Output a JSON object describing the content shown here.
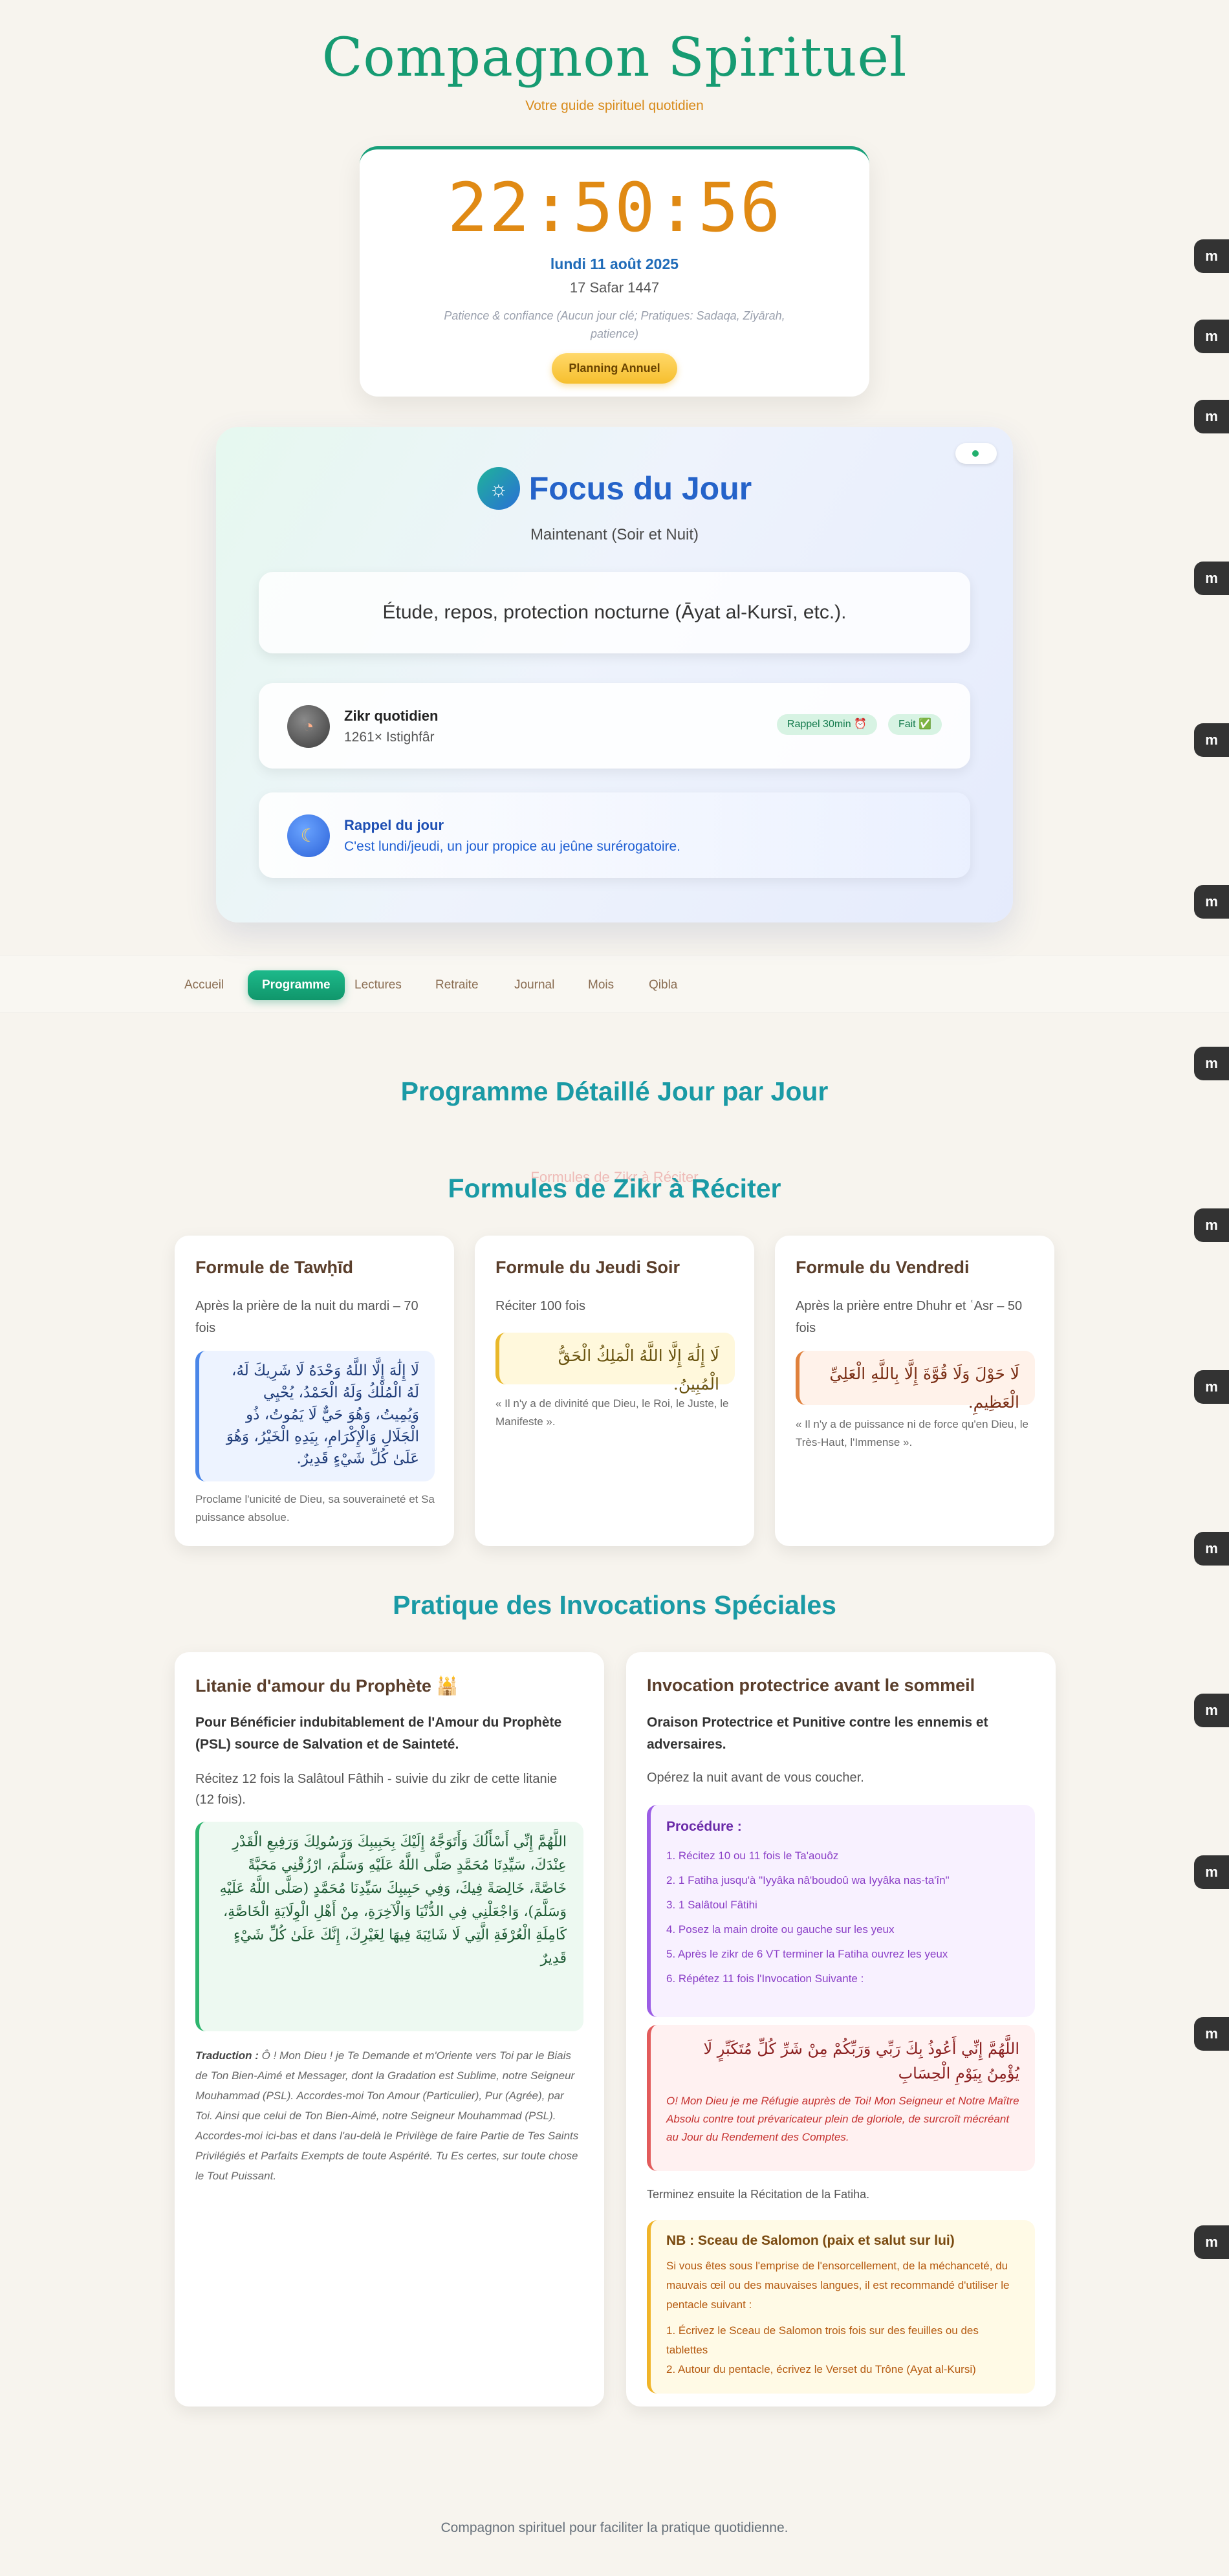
{
  "header": {
    "title": "Compagnon Spirituel",
    "subtitle": "Votre guide spirituel quotidien"
  },
  "clock": {
    "time": "22:50:56",
    "date": "lundi 11 août 2025",
    "hijri": "17 Safar 1447",
    "note": "Patience & confiance (Aucun jour clé; Pratiques: Sadaqa, Ziyārah, patience)",
    "planning_button": "Planning Annuel"
  },
  "focus": {
    "title": "Focus du Jour",
    "subtitle": "Maintenant (Soir et Nuit)",
    "main": "Étude, repos, protection nocturne (Āyat al-Kursī, etc.).",
    "zikr": {
      "title": "Zikr quotidien",
      "text": "1261× Istighfâr",
      "chip_rappel": "Rappel 30min ⏰",
      "chip_fait": "Fait ✅"
    },
    "rappel": {
      "title": "Rappel du jour",
      "text": "C'est lundi/jeudi, un jour propice au jeûne surérogatoire."
    }
  },
  "nav": {
    "items": [
      {
        "label": "Accueil"
      },
      {
        "label": "Programme"
      },
      {
        "label": "Lectures"
      },
      {
        "label": "Retraite"
      },
      {
        "label": "Journal"
      },
      {
        "label": "Mois"
      },
      {
        "label": "Qibla"
      }
    ],
    "active": "Programme"
  },
  "program": {
    "title": "Programme Détaillé Jour par Jour",
    "ghost": "Formules de Zikr à Réciter"
  },
  "formulas": {
    "title": "Formules de Zikr à Réciter",
    "cards": [
      {
        "title": "Formule de Tawḥīd",
        "when": "Après la prière de la nuit du mardi – 70 fois",
        "arabic": "لَا إِلَٰهَ إِلَّا اللَّهُ وَحْدَهُ لَا شَرِيكَ لَهُ، لَهُ الْمُلْكُ وَلَهُ الْحَمْدُ، يُحْيِي وَيُمِيتُ، وَهُوَ حَيٌّ لَا يَمُوتُ، ذُو الْجَلَالِ وَالْإِكْرَامِ، بِيَدِهِ الْخَيْرُ، وَهُوَ عَلَىٰ كُلِّ شَيْءٍ قَدِيرٌ.",
        "desc": "Proclame l'unicité de Dieu, sa souveraineté et Sa puissance absolue."
      },
      {
        "title": "Formule du Jeudi Soir",
        "when": "Réciter 100 fois",
        "arabic": "لَا إِلَٰهَ إِلَّا اللَّهُ الْمَلِكُ الْحَقُّ الْمُبِينُ.",
        "desc": "« Il n'y a de divinité que Dieu, le Roi, le Juste, le Manifeste »."
      },
      {
        "title": "Formule du Vendredi",
        "when": "Après la prière entre Dhuhr et ʿAsr – 50 fois",
        "arabic": "لَا حَوْلَ وَلَا قُوَّةَ إِلَّا بِاللَّهِ الْعَلِيِّ الْعَظِيمِ.",
        "desc": "« Il n'y a de puissance ni de force qu'en Dieu, le Très-Haut, l'Immense »."
      }
    ]
  },
  "invocations": {
    "title": "Pratique des Invocations Spéciales",
    "litanie": {
      "title": "Litanie d'amour du Prophète 🕌",
      "lead": "Pour Bénéficier indubitablement de l'Amour du Prophète (PSL) source de Salvation et de Sainteté.",
      "text": "Récitez 12 fois la Salâtoul Fâthih - suivie du zikr de cette litanie (12 fois).",
      "arabic": "اللَّهُمَّ إِنِّي أَسْأَلُكَ وَأَتَوَجَّهُ إِلَيْكَ بِحَبِيبِكَ وَرَسُولِكَ وَرَفِيعِ الْقَدْرِ عِنْدَكَ، سَيِّدِنَا مُحَمَّدٍ صَلَّى اللَّهُ عَلَيْهِ وَسَلَّمَ، ارْزُقْنِي مَحَبَّةً خَاصَّةً، خَالِصَةً فِيكَ، وَفِي حَبِيبِكَ سَيِّدِنَا مُحَمَّدٍ (صَلَّى اللَّهُ عَلَيْهِ وَسَلَّمَ)، وَاجْعَلْنِي فِي الدُّنْيَا وَالْآخِرَةِ، مِنْ أَهْلِ الْوِلَايَةِ الْخَاصَّةِ، كَامِلَةِ الْعُرْفَةِ الَّتِي لَا شَائِبَةَ فِيهَا لِغَيْرِكَ، إِنَّكَ عَلَىٰ كُلِّ شَيْءٍ قَدِيرٌ",
      "translation_label": "Traduction :",
      "translation": "Ô ! Mon Dieu ! je Te Demande et m'Oriente vers Toi par le Biais de Ton Bien-Aimé et Messager, dont la Gradation est Sublime, notre Seigneur Mouhammad (PSL). Accordes-moi Ton Amour (Particulier), Pur (Agrée), par Toi. Ainsi que celui de Ton Bien-Aimé, notre Seigneur Mouhammad (PSL). Accordes-moi ici-bas et dans l'au-delà le Privilège de faire Partie de Tes Saints Privilégiés et Parfaits Exempts de toute Aspérité. Tu Es certes, sur toute chose le Tout Puissant."
    },
    "sommeil": {
      "title": "Invocation protectrice avant le sommeil",
      "lead": "Oraison Protectrice et Punitive contre les ennemis et adversaires.",
      "text": "Opérez la nuit avant de vous coucher.",
      "procedure_title": "Procédure :",
      "steps": [
        "1. Récitez 10 ou 11 fois le Ta'aouôz",
        "2. 1 Fatiha jusqu'à \"Iyyâka nâ'boudoû wa Iyyâka nas-ta'în\"",
        "3. 1 Salâtoul Fâtihi",
        "4. Posez la main droite ou gauche sur les yeux",
        "5. Après le zikr de 6 VT terminer la Fatiha ouvrez les yeux",
        "6. Répétez 11 fois l'Invocation Suivante :"
      ],
      "arabic": "اللَّهُمَّ إِنِّي أَعُوذُ بِكَ رَبِّي وَرَبِّكُمْ مِنْ شَرِّ كُلِّ مُتَكَبِّرٍ لَا يُؤْمِنُ بِيَوْمِ الْحِسَابِ",
      "french": "O! Mon Dieu je me Réfugie auprès de Toi! Mon Seigneur et Notre Maître Absolu contre tout prévaricateur plein de gloriole, de surcroît mécréant au Jour du Rendement des Comptes.",
      "fatiha_end": "Terminez ensuite la Récitation de la Fatiha.",
      "nb_title": "NB : Sceau de Salomon (paix et salut sur lui)",
      "nb_text": "Si vous êtes sous l'emprise de l'ensorcellement, de la méchanceté, du mauvais œil ou des mauvaises langues, il est recommandé d'utiliser le pentacle suivant :",
      "nb_steps": [
        "1. Écrivez le Sceau de Salomon trois fois sur des feuilles ou des tablettes",
        "2. Autour du pentacle, écrivez le Verset du Trône (Ayat al-Kursi)"
      ]
    }
  },
  "footer": {
    "text": "Compagnon spirituel pour faciliter la pratique quotidienne."
  },
  "side_widget": {
    "glyph": "m"
  }
}
